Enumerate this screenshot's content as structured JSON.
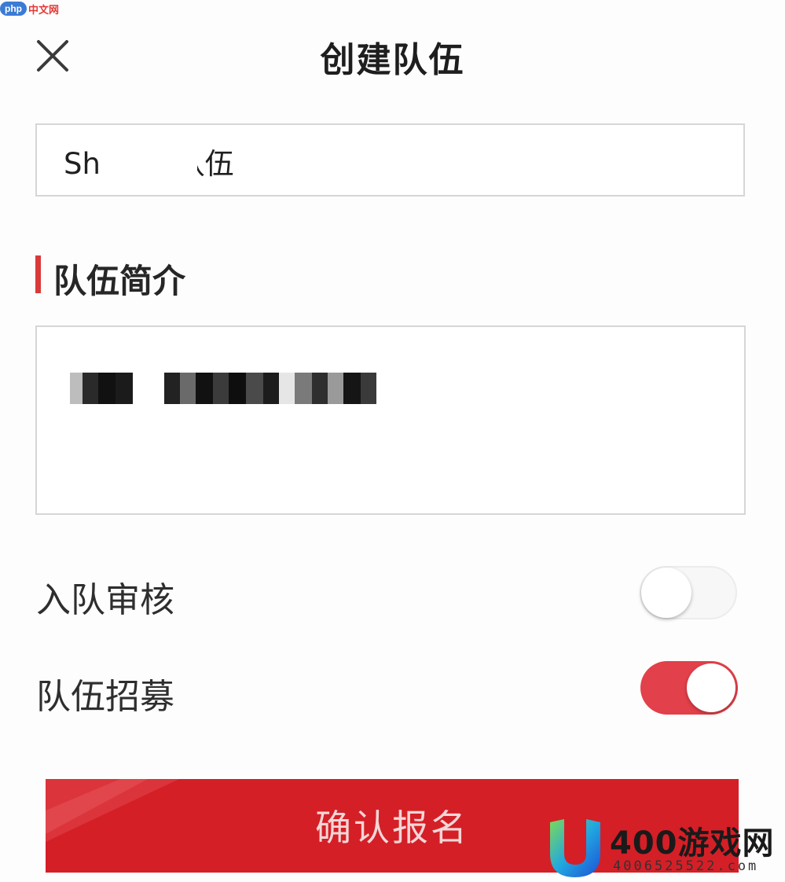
{
  "watermark_top": {
    "badge": "php",
    "text": "中文网"
  },
  "header": {
    "title": "创建队伍",
    "close_icon": "close-icon"
  },
  "team_name": {
    "value": "Sh   n的队伍"
  },
  "intro_section": {
    "title": "队伍简介",
    "accent_color": "#d93a3a",
    "text_value": ""
  },
  "toggles": [
    {
      "label": "入队审核",
      "on": false
    },
    {
      "label": "队伍招募",
      "on": true
    }
  ],
  "confirm": {
    "label": "确认报名",
    "color": "#d41f27"
  },
  "watermark_bottom": {
    "brand": "400游戏网",
    "phone": "4006525522.com",
    "logo": "u-logo-icon"
  }
}
